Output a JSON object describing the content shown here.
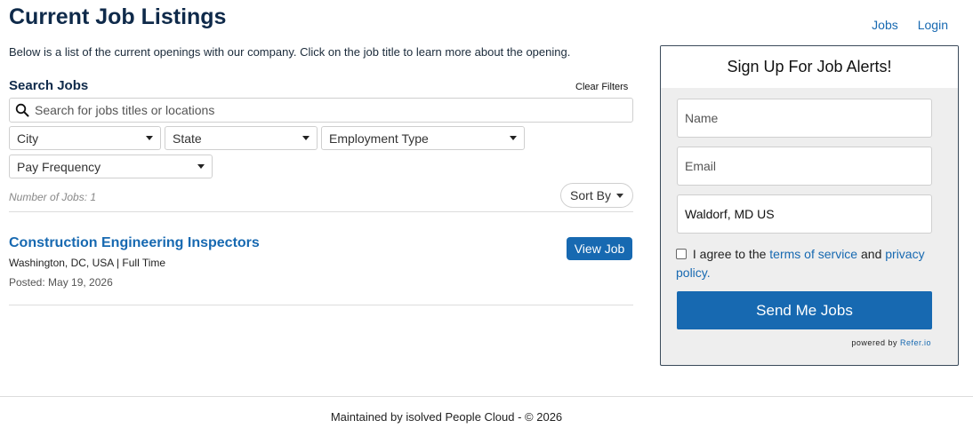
{
  "page": {
    "title": "Current Job Listings",
    "intro": "Below is a list of the current openings with our company. Click on the job title to learn more about the opening."
  },
  "nav": {
    "jobs": "Jobs",
    "login": "Login"
  },
  "search": {
    "heading": "Search Jobs",
    "clear_filters": "Clear Filters",
    "placeholder": "Search for jobs titles or locations",
    "icon": "search-icon",
    "filters": {
      "city": "City",
      "state": "State",
      "employment_type": "Employment Type",
      "pay_frequency": "Pay Frequency"
    }
  },
  "results": {
    "count_label": "Number of Jobs: 1",
    "sort_label": "Sort By",
    "jobs": [
      {
        "title": "Construction Engineering Inspectors",
        "location": "Washington, DC, USA",
        "type": "Full Time",
        "posted": "Posted: May 19, 2026",
        "button": "View Job"
      }
    ]
  },
  "signup": {
    "heading": "Sign Up For Job Alerts!",
    "name_placeholder": "Name",
    "email_placeholder": "Email",
    "location_value": "Waldorf, MD US",
    "agree_prefix": "I agree to the",
    "terms_link": "terms of service",
    "and_text": "and",
    "privacy_link": "privacy policy.",
    "submit": "Send Me Jobs",
    "powered_prefix": "powered by",
    "powered_brand": "Refer.io",
    "agree_checked": false
  },
  "footer": {
    "text": "Maintained by isolved People Cloud - © 2026"
  },
  "colors": {
    "brand": "#1769b1",
    "title": "#0f2a4a",
    "panel_bg": "#eeeeee"
  }
}
